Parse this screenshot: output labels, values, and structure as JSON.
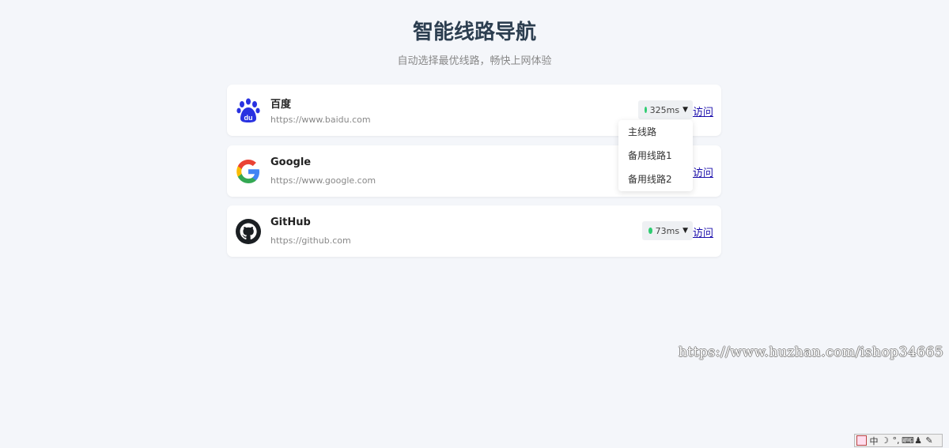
{
  "header": {
    "title": "智能线路导航",
    "subtitle": "自动选择最优线路，畅快上网体验"
  },
  "sites": [
    {
      "name": "百度",
      "url": "https://www.baidu.com",
      "latency": "325ms",
      "visit_label": "访问",
      "icon": "baidu-paw-icon"
    },
    {
      "name": "Google",
      "url": "https://www.google.com",
      "latency": "",
      "visit_label": "访问",
      "icon": "google-g-icon"
    },
    {
      "name": "GitHub",
      "url": "https://github.com",
      "latency": "73ms",
      "visit_label": "访问",
      "icon": "github-octocat-icon"
    }
  ],
  "route_menu": {
    "items": [
      "主线路",
      "备用线路1",
      "备用线路2"
    ]
  },
  "watermark": "https://www.huzhan.com/ishop34665",
  "ime_toolbar": {
    "mode": "中",
    "icons": [
      "ime-logo-icon",
      "moon-icon",
      "punctuation-icon",
      "keyboard-icon",
      "user-icon",
      "wrench-icon"
    ]
  },
  "colors": {
    "background": "#f4f6fa",
    "status_good": "#2ecc71",
    "link": "#1a0dab",
    "title": "#2c3e50"
  }
}
